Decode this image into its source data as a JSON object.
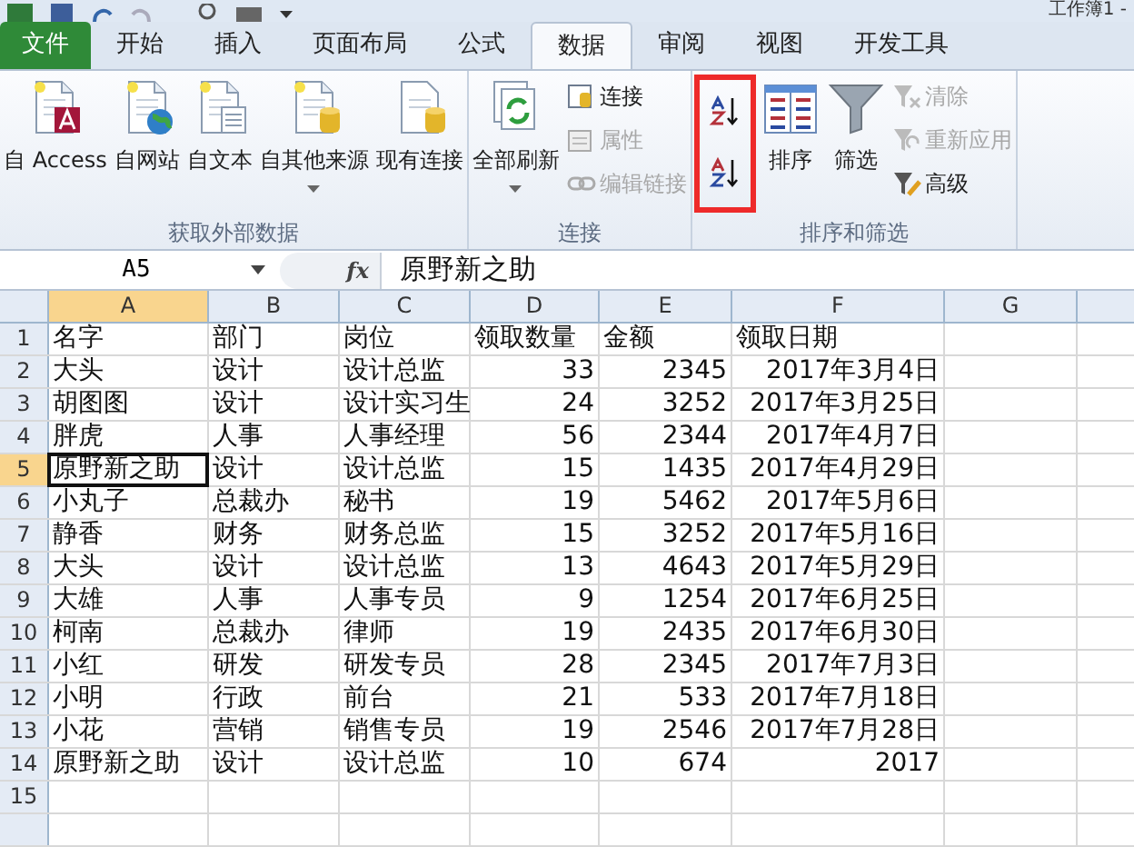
{
  "title_bar": {
    "title": "工作簿1 -"
  },
  "tabs": [
    {
      "label": "文件",
      "kind": "file",
      "selected": false
    },
    {
      "label": "开始",
      "kind": "tab",
      "selected": false
    },
    {
      "label": "插入",
      "kind": "tab",
      "selected": false
    },
    {
      "label": "页面布局",
      "kind": "tab",
      "selected": false
    },
    {
      "label": "公式",
      "kind": "tab",
      "selected": false
    },
    {
      "label": "数据",
      "kind": "tab",
      "selected": true
    },
    {
      "label": "审阅",
      "kind": "tab",
      "selected": false
    },
    {
      "label": "视图",
      "kind": "tab",
      "selected": false
    },
    {
      "label": "开发工具",
      "kind": "tab",
      "selected": false
    }
  ],
  "ribbon_groups": [
    {
      "title": "获取外部数据",
      "columns": [
        {
          "highlighted": false,
          "buttons": [
            {
              "kind": "large",
              "label": "自 Access",
              "dropdown": false,
              "disabled": false
            }
          ]
        },
        {
          "highlighted": false,
          "buttons": [
            {
              "kind": "large",
              "label": "自网站",
              "dropdown": false,
              "disabled": false
            }
          ]
        },
        {
          "highlighted": false,
          "buttons": [
            {
              "kind": "large",
              "label": "自文本",
              "dropdown": false,
              "disabled": false
            }
          ]
        },
        {
          "highlighted": false,
          "buttons": [
            {
              "kind": "large",
              "label": "自其他来源",
              "dropdown": true,
              "disabled": false
            }
          ]
        },
        {
          "highlighted": false,
          "buttons": [
            {
              "kind": "large",
              "label": "现有连接",
              "dropdown": false,
              "disabled": false
            }
          ]
        }
      ]
    },
    {
      "title": "连接",
      "columns": [
        {
          "highlighted": false,
          "buttons": [
            {
              "kind": "large",
              "label": "全部刷新",
              "dropdown": true,
              "disabled": false
            }
          ]
        },
        {
          "highlighted": false,
          "buttons": [
            {
              "kind": "small",
              "label": "连接",
              "disabled": false
            },
            {
              "kind": "small",
              "label": "属性",
              "disabled": true
            },
            {
              "kind": "small",
              "label": "编辑链接",
              "disabled": true
            }
          ]
        }
      ]
    },
    {
      "title": "排序和筛选",
      "columns": [
        {
          "highlighted": true,
          "buttons": [
            {
              "kind": "icon",
              "disabled": false
            },
            {
              "kind": "icon",
              "disabled": false
            }
          ]
        },
        {
          "highlighted": false,
          "buttons": [
            {
              "kind": "large",
              "label": "排序",
              "dropdown": false,
              "disabled": false
            }
          ]
        },
        {
          "highlighted": false,
          "buttons": [
            {
              "kind": "large",
              "label": "筛选",
              "dropdown": false,
              "disabled": false
            }
          ]
        },
        {
          "highlighted": false,
          "buttons": [
            {
              "kind": "small",
              "label": "清除",
              "disabled": true
            },
            {
              "kind": "small",
              "label": "重新应用",
              "disabled": true
            },
            {
              "kind": "small",
              "label": "高级",
              "disabled": false
            }
          ]
        }
      ]
    }
  ],
  "formula_bar": {
    "name_box": "A5",
    "function_label": "fx",
    "value": "原野新之助"
  },
  "sheet": {
    "columns": [
      {
        "label": "A",
        "selected": true
      },
      {
        "label": "B",
        "selected": false
      },
      {
        "label": "C",
        "selected": false
      },
      {
        "label": "D",
        "selected": false
      },
      {
        "label": "E",
        "selected": false
      },
      {
        "label": "F",
        "selected": false
      },
      {
        "label": "G",
        "selected": false
      }
    ],
    "rows": [
      {
        "number": "1",
        "selected": false,
        "cells": [
          {
            "text": "名字",
            "kind": "text"
          },
          {
            "text": "部门",
            "kind": "text"
          },
          {
            "text": "岗位",
            "kind": "text"
          },
          {
            "text": "领取数量",
            "kind": "text"
          },
          {
            "text": "金额",
            "kind": "text"
          },
          {
            "text": "领取日期",
            "kind": "text"
          }
        ]
      },
      {
        "number": "2",
        "selected": false,
        "cells": [
          {
            "text": "大头",
            "kind": "text"
          },
          {
            "text": "设计",
            "kind": "text"
          },
          {
            "text": "设计总监",
            "kind": "text"
          },
          {
            "text": "33",
            "kind": "number"
          },
          {
            "text": "2345",
            "kind": "number"
          },
          {
            "text": "2017年3月4日",
            "kind": "number"
          }
        ]
      },
      {
        "number": "3",
        "selected": false,
        "cells": [
          {
            "text": "胡图图",
            "kind": "text"
          },
          {
            "text": "设计",
            "kind": "text"
          },
          {
            "text": "设计实习生",
            "kind": "text"
          },
          {
            "text": "24",
            "kind": "number"
          },
          {
            "text": "3252",
            "kind": "number"
          },
          {
            "text": "2017年3月25日",
            "kind": "number"
          }
        ]
      },
      {
        "number": "4",
        "selected": false,
        "cells": [
          {
            "text": "胖虎",
            "kind": "text"
          },
          {
            "text": "人事",
            "kind": "text"
          },
          {
            "text": "人事经理",
            "kind": "text"
          },
          {
            "text": "56",
            "kind": "number"
          },
          {
            "text": "2344",
            "kind": "number"
          },
          {
            "text": "2017年4月7日",
            "kind": "number"
          }
        ]
      },
      {
        "number": "5",
        "selected": true,
        "cells": [
          {
            "text": "原野新之助",
            "kind": "text"
          },
          {
            "text": "设计",
            "kind": "text"
          },
          {
            "text": "设计总监",
            "kind": "text"
          },
          {
            "text": "15",
            "kind": "number"
          },
          {
            "text": "1435",
            "kind": "number"
          },
          {
            "text": "2017年4月29日",
            "kind": "number"
          }
        ]
      },
      {
        "number": "6",
        "selected": false,
        "cells": [
          {
            "text": "小丸子",
            "kind": "text"
          },
          {
            "text": "总裁办",
            "kind": "text"
          },
          {
            "text": "秘书",
            "kind": "text"
          },
          {
            "text": "19",
            "kind": "number"
          },
          {
            "text": "5462",
            "kind": "number"
          },
          {
            "text": "2017年5月6日",
            "kind": "number"
          }
        ]
      },
      {
        "number": "7",
        "selected": false,
        "cells": [
          {
            "text": "静香",
            "kind": "text"
          },
          {
            "text": "财务",
            "kind": "text"
          },
          {
            "text": "财务总监",
            "kind": "text"
          },
          {
            "text": "15",
            "kind": "number"
          },
          {
            "text": "3252",
            "kind": "number"
          },
          {
            "text": "2017年5月16日",
            "kind": "number"
          }
        ]
      },
      {
        "number": "8",
        "selected": false,
        "cells": [
          {
            "text": "大头",
            "kind": "text"
          },
          {
            "text": "设计",
            "kind": "text"
          },
          {
            "text": "设计总监",
            "kind": "text"
          },
          {
            "text": "13",
            "kind": "number"
          },
          {
            "text": "4643",
            "kind": "number"
          },
          {
            "text": "2017年5月29日",
            "kind": "number"
          }
        ]
      },
      {
        "number": "9",
        "selected": false,
        "cells": [
          {
            "text": "大雄",
            "kind": "text"
          },
          {
            "text": "人事",
            "kind": "text"
          },
          {
            "text": "人事专员",
            "kind": "text"
          },
          {
            "text": "9",
            "kind": "number"
          },
          {
            "text": "1254",
            "kind": "number"
          },
          {
            "text": "2017年6月25日",
            "kind": "number"
          }
        ]
      },
      {
        "number": "10",
        "selected": false,
        "cells": [
          {
            "text": "柯南",
            "kind": "text"
          },
          {
            "text": "总裁办",
            "kind": "text"
          },
          {
            "text": "律师",
            "kind": "text"
          },
          {
            "text": "19",
            "kind": "number"
          },
          {
            "text": "2435",
            "kind": "number"
          },
          {
            "text": "2017年6月30日",
            "kind": "number"
          }
        ]
      },
      {
        "number": "11",
        "selected": false,
        "cells": [
          {
            "text": "小红",
            "kind": "text"
          },
          {
            "text": "研发",
            "kind": "text"
          },
          {
            "text": "研发专员",
            "kind": "text"
          },
          {
            "text": "28",
            "kind": "number"
          },
          {
            "text": "2345",
            "kind": "number"
          },
          {
            "text": "2017年7月3日",
            "kind": "number"
          }
        ]
      },
      {
        "number": "12",
        "selected": false,
        "cells": [
          {
            "text": "小明",
            "kind": "text"
          },
          {
            "text": "行政",
            "kind": "text"
          },
          {
            "text": "前台",
            "kind": "text"
          },
          {
            "text": "21",
            "kind": "number"
          },
          {
            "text": "533",
            "kind": "number"
          },
          {
            "text": "2017年7月18日",
            "kind": "number"
          }
        ]
      },
      {
        "number": "13",
        "selected": false,
        "cells": [
          {
            "text": "小花",
            "kind": "text"
          },
          {
            "text": "营销",
            "kind": "text"
          },
          {
            "text": "销售专员",
            "kind": "text"
          },
          {
            "text": "19",
            "kind": "number"
          },
          {
            "text": "2546",
            "kind": "number"
          },
          {
            "text": "2017年7月28日",
            "kind": "number"
          }
        ]
      },
      {
        "number": "14",
        "selected": false,
        "cells": [
          {
            "text": "原野新之助",
            "kind": "text"
          },
          {
            "text": "设计",
            "kind": "text"
          },
          {
            "text": "设计总监",
            "kind": "text"
          },
          {
            "text": "10",
            "kind": "number"
          },
          {
            "text": "674",
            "kind": "number"
          },
          {
            "text": "2017",
            "kind": "partial"
          }
        ]
      },
      {
        "number": "15",
        "selected": false,
        "cells": []
      }
    ]
  }
}
